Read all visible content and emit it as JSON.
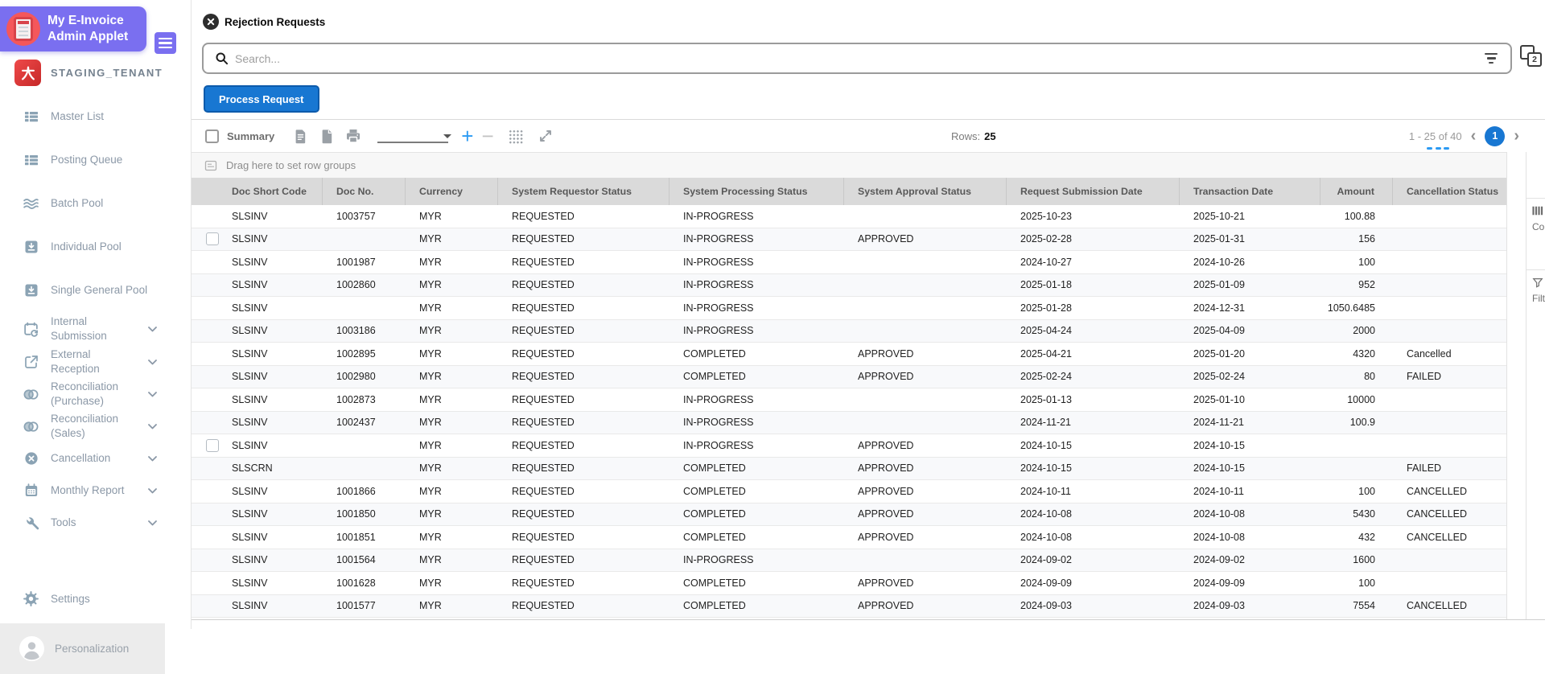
{
  "app": {
    "title_line1": "My E-Invoice",
    "title_line2": "Admin Applet"
  },
  "tenant_name": "STAGING_TENANT",
  "sidebar": {
    "items": [
      {
        "id": "master-list",
        "lines": [
          "Master List"
        ],
        "icon": "list",
        "chevron": false
      },
      {
        "id": "posting-queue",
        "lines": [
          "Posting Queue"
        ],
        "icon": "list",
        "chevron": false
      },
      {
        "id": "batch-pool",
        "lines": [
          "Batch Pool"
        ],
        "icon": "waves",
        "chevron": false
      },
      {
        "id": "individual-pool",
        "lines": [
          "Individual Pool"
        ],
        "icon": "pool",
        "chevron": false
      },
      {
        "id": "single-general-pool",
        "lines": [
          "Single General Pool"
        ],
        "icon": "pool",
        "chevron": false
      },
      {
        "id": "internal-submission",
        "lines": [
          "Internal",
          "Submission"
        ],
        "icon": "calendar-sync",
        "chevron": true
      },
      {
        "id": "external-reception",
        "lines": [
          "External",
          "Reception"
        ],
        "icon": "external-link",
        "chevron": true
      },
      {
        "id": "reconciliation-purchase",
        "lines": [
          "Reconciliation",
          "(Purchase)"
        ],
        "icon": "venn",
        "chevron": true
      },
      {
        "id": "reconciliation-sales",
        "lines": [
          "Reconciliation",
          "(Sales)"
        ],
        "icon": "venn",
        "chevron": true
      },
      {
        "id": "cancellation",
        "lines": [
          "Cancellation"
        ],
        "icon": "circle-x",
        "chevron": true
      },
      {
        "id": "monthly-report",
        "lines": [
          "Monthly Report"
        ],
        "icon": "calendar",
        "chevron": true
      },
      {
        "id": "tools",
        "lines": [
          "Tools"
        ],
        "icon": "wrench",
        "chevron": true
      }
    ],
    "settings_label": "Settings",
    "personalization_label": "Personalization"
  },
  "header": {
    "page_title": "Rejection Requests",
    "search_placeholder": "Search...",
    "process_button": "Process Request",
    "window_badge": "2"
  },
  "toolbar": {
    "summary_label": "Summary",
    "rows_label": "Rows:",
    "rows_value": "25",
    "pagination_range": "1 - 25 of 40",
    "current_page": "1"
  },
  "grid": {
    "drag_hint": "Drag here to set row groups",
    "side_panel": {
      "columns_label": "Columns",
      "filters_label": "Filters"
    },
    "columns": [
      "Doc Short Code",
      "Doc No.",
      "Currency",
      "System Requestor Status",
      "System Processing Status",
      "System Approval Status",
      "Request Submission Date",
      "Transaction Date",
      "Amount",
      "Cancellation Status"
    ],
    "rows": [
      {
        "checkbox": false,
        "cells": [
          "SLSINV",
          "1003757",
          "MYR",
          "REQUESTED",
          "IN-PROGRESS",
          "",
          "2025-10-23",
          "2025-10-21",
          "100.88",
          ""
        ]
      },
      {
        "checkbox": true,
        "cells": [
          "SLSINV",
          "",
          "MYR",
          "REQUESTED",
          "IN-PROGRESS",
          "APPROVED",
          "2025-02-28",
          "2025-01-31",
          "156",
          ""
        ]
      },
      {
        "checkbox": false,
        "cells": [
          "SLSINV",
          "1001987",
          "MYR",
          "REQUESTED",
          "IN-PROGRESS",
          "",
          "2024-10-27",
          "2024-10-26",
          "100",
          ""
        ]
      },
      {
        "checkbox": false,
        "cells": [
          "SLSINV",
          "1002860",
          "MYR",
          "REQUESTED",
          "IN-PROGRESS",
          "",
          "2025-01-18",
          "2025-01-09",
          "952",
          ""
        ]
      },
      {
        "checkbox": false,
        "cells": [
          "SLSINV",
          "",
          "MYR",
          "REQUESTED",
          "IN-PROGRESS",
          "",
          "2025-01-28",
          "2024-12-31",
          "1050.6485",
          ""
        ]
      },
      {
        "checkbox": false,
        "cells": [
          "SLSINV",
          "1003186",
          "MYR",
          "REQUESTED",
          "IN-PROGRESS",
          "",
          "2025-04-24",
          "2025-04-09",
          "2000",
          ""
        ]
      },
      {
        "checkbox": false,
        "cells": [
          "SLSINV",
          "1002895",
          "MYR",
          "REQUESTED",
          "COMPLETED",
          "APPROVED",
          "2025-04-21",
          "2025-01-20",
          "4320",
          "Cancelled"
        ]
      },
      {
        "checkbox": false,
        "cells": [
          "SLSINV",
          "1002980",
          "MYR",
          "REQUESTED",
          "COMPLETED",
          "APPROVED",
          "2025-02-24",
          "2025-02-24",
          "80",
          "FAILED"
        ]
      },
      {
        "checkbox": false,
        "cells": [
          "SLSINV",
          "1002873",
          "MYR",
          "REQUESTED",
          "IN-PROGRESS",
          "",
          "2025-01-13",
          "2025-01-10",
          "10000",
          ""
        ]
      },
      {
        "checkbox": false,
        "cells": [
          "SLSINV",
          "1002437",
          "MYR",
          "REQUESTED",
          "IN-PROGRESS",
          "",
          "2024-11-21",
          "2024-11-21",
          "100.9",
          ""
        ]
      },
      {
        "checkbox": true,
        "cells": [
          "SLSINV",
          "",
          "MYR",
          "REQUESTED",
          "IN-PROGRESS",
          "APPROVED",
          "2024-10-15",
          "2024-10-15",
          "",
          ""
        ]
      },
      {
        "checkbox": false,
        "cells": [
          "SLSCRN",
          "",
          "MYR",
          "REQUESTED",
          "COMPLETED",
          "APPROVED",
          "2024-10-15",
          "2024-10-15",
          "",
          "FAILED"
        ]
      },
      {
        "checkbox": false,
        "cells": [
          "SLSINV",
          "1001866",
          "MYR",
          "REQUESTED",
          "COMPLETED",
          "APPROVED",
          "2024-10-11",
          "2024-10-11",
          "100",
          "CANCELLED"
        ]
      },
      {
        "checkbox": false,
        "cells": [
          "SLSINV",
          "1001850",
          "MYR",
          "REQUESTED",
          "COMPLETED",
          "APPROVED",
          "2024-10-08",
          "2024-10-08",
          "5430",
          "CANCELLED"
        ]
      },
      {
        "checkbox": false,
        "cells": [
          "SLSINV",
          "1001851",
          "MYR",
          "REQUESTED",
          "COMPLETED",
          "APPROVED",
          "2024-10-08",
          "2024-10-08",
          "432",
          "CANCELLED"
        ]
      },
      {
        "checkbox": false,
        "cells": [
          "SLSINV",
          "1001564",
          "MYR",
          "REQUESTED",
          "IN-PROGRESS",
          "",
          "2024-09-02",
          "2024-09-02",
          "1600",
          ""
        ]
      },
      {
        "checkbox": false,
        "cells": [
          "SLSINV",
          "1001628",
          "MYR",
          "REQUESTED",
          "COMPLETED",
          "APPROVED",
          "2024-09-09",
          "2024-09-09",
          "100",
          ""
        ]
      },
      {
        "checkbox": false,
        "cells": [
          "SLSINV",
          "1001577",
          "MYR",
          "REQUESTED",
          "COMPLETED",
          "APPROVED",
          "2024-09-03",
          "2024-09-03",
          "7554",
          "CANCELLED"
        ]
      }
    ]
  },
  "colors": {
    "brand_purple": "#7a6ff0",
    "accent_blue": "#1877d2",
    "logo_red": "#d8434a",
    "icon_blue": "#2b9af3"
  }
}
